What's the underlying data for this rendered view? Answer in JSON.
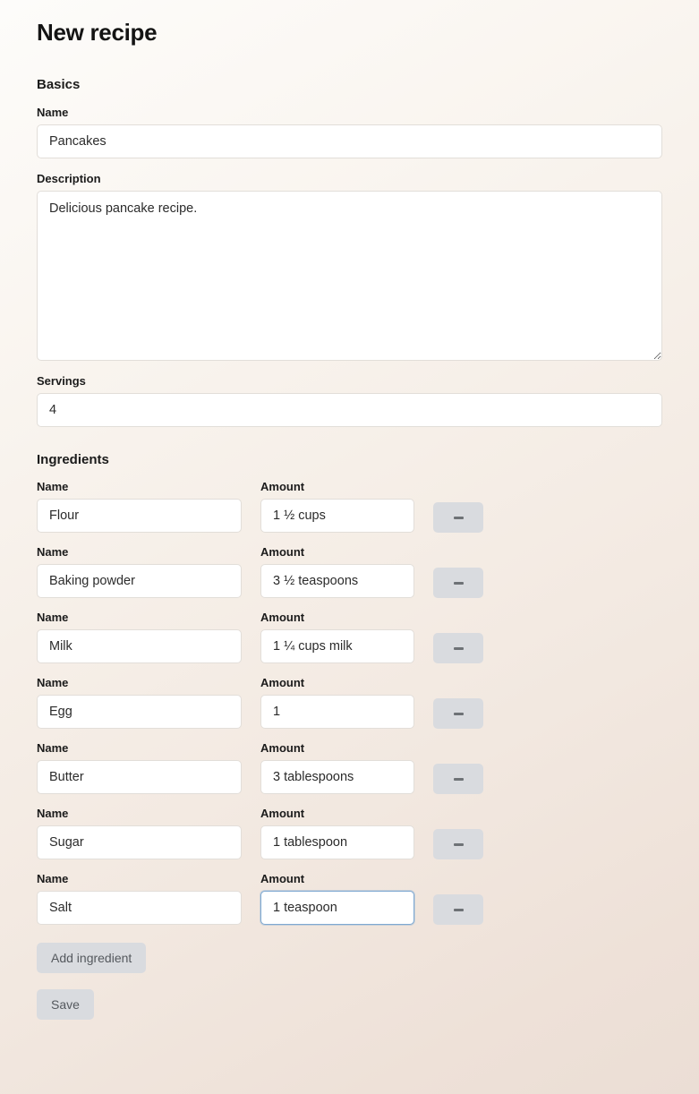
{
  "page": {
    "title": "New recipe"
  },
  "sections": {
    "basics": {
      "heading": "Basics",
      "name": {
        "label": "Name",
        "value": "Pancakes"
      },
      "description": {
        "label": "Description",
        "value": "Delicious pancake recipe."
      },
      "servings": {
        "label": "Servings",
        "value": "4"
      }
    },
    "ingredients": {
      "heading": "Ingredients",
      "name_label": "Name",
      "amount_label": "Amount",
      "remove_icon": "minus-icon",
      "rows": [
        {
          "name": "Flour",
          "amount": "1 ½ cups",
          "focused": false
        },
        {
          "name": "Baking powder",
          "amount": "3 ½ teaspoons",
          "focused": false
        },
        {
          "name": "Milk",
          "amount": "1 ¼ cups milk",
          "focused": false
        },
        {
          "name": "Egg",
          "amount": "1",
          "focused": false
        },
        {
          "name": "Butter",
          "amount": "3 tablespoons",
          "focused": false
        },
        {
          "name": "Sugar",
          "amount": "1 tablespoon",
          "focused": false
        },
        {
          "name": "Salt",
          "amount": "1 teaspoon",
          "focused": true
        }
      ],
      "add_label": "Add ingredient"
    }
  },
  "footer": {
    "save_label": "Save"
  },
  "colors": {
    "focus_border": "#7fa9d2",
    "button_bg": "#d9dbdf",
    "button_text": "#55595e",
    "input_bg": "#ffffff",
    "input_border": "#e2ded9",
    "text": "#1f1f1f"
  }
}
